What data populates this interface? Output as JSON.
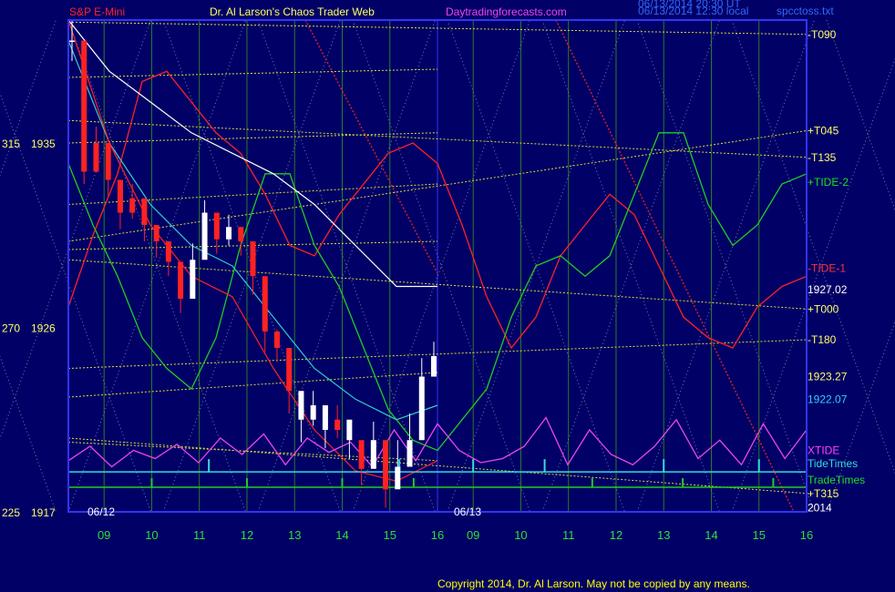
{
  "header": {
    "instrument": "S&P E-Mini",
    "title": "Dr. Al Larson's Chaos Trader Web",
    "site": "Daytradingforecasts.com",
    "stamp1": "06/13/2014 20:30 UT",
    "stamp2": "06/13/2014 12:30 local",
    "file": "spcctoss.txt"
  },
  "footer": {
    "copyright": "Copyright 2014, Dr. Al Larson. May not be copied by any means."
  },
  "colors": {
    "background": "#000066",
    "frame": "#3333ff",
    "grid": "#2a7a2a",
    "price_up": "#ffffff",
    "price_down": "#ff2222",
    "tide1": "#ff2222",
    "tide2": "#22cc22",
    "xtide": "#ee44ee",
    "tidetimes": "#33dddd",
    "tradetimes": "#22cc22",
    "tlines": "#dddd33",
    "ma_white": "#ffffff",
    "ma_cyan": "#33cccc",
    "ma_red": "#ff2222"
  },
  "chart_data": {
    "type": "line",
    "title": "S&P E-Mini",
    "xlabel": "",
    "ylabel": "",
    "ylim": [
      1917,
      1941
    ],
    "grid": true,
    "x_hours": [
      9,
      10,
      11,
      12,
      13,
      14,
      15,
      16
    ],
    "x_tick_labels": [
      "09",
      "10",
      "11",
      "12",
      "13",
      "14",
      "15",
      "16",
      "09",
      "10",
      "11",
      "12",
      "13",
      "14",
      "15",
      "16"
    ],
    "date_labels": [
      "06/12",
      "06/13"
    ],
    "y_tick_labels": [
      {
        "left": "315",
        "price": "1935",
        "value": 1935
      },
      {
        "left": "270",
        "price": "1926",
        "value": 1926
      },
      {
        "left": "225",
        "price": "1917",
        "value": 1917
      }
    ],
    "right_labels": [
      {
        "text": "-T090",
        "value": 1940.3,
        "color": "#ffff66"
      },
      {
        "text": "+T045",
        "value": 1935.6,
        "color": "#ffff66"
      },
      {
        "text": "-T135",
        "value": 1934.3,
        "color": "#ffff66"
      },
      {
        "text": "+TIDE-2",
        "value": 1933.1,
        "color": "#22dd22"
      },
      {
        "text": "-TIDE-1",
        "value": 1928.9,
        "color": "#ff3333"
      },
      {
        "text": "1927.02",
        "value": 1927.85,
        "color": "#ffffff"
      },
      {
        "text": "+T000",
        "value": 1926.9,
        "color": "#ffff66"
      },
      {
        "text": "-T180",
        "value": 1925.4,
        "color": "#ffff66"
      },
      {
        "text": "1923.27",
        "value": 1923.6,
        "color": "#ffff66"
      },
      {
        "text": "1922.07",
        "value": 1922.5,
        "color": "#33ccff"
      },
      {
        "text": "XTIDE",
        "value": 1920.0,
        "color": "#ff44ff"
      },
      {
        "text": "TideTimes",
        "value": 1919.35,
        "color": "#33dddd"
      },
      {
        "text": "TradeTimes",
        "value": 1918.55,
        "color": "#22dd22"
      },
      {
        "text": "+T315",
        "value": 1917.9,
        "color": "#ffff66"
      },
      {
        "text": "2014",
        "value": 1917.2,
        "color": "#ffffff"
      }
    ],
    "series": [
      {
        "name": "S&P E-Mini",
        "day1_close": [
          1940.0,
          1933.6,
          1935.0,
          1933.2,
          1931.6,
          1932.3,
          1931.0,
          1930.2,
          1929.2,
          1927.4,
          1929.3,
          1931.6,
          1930.3,
          1930.9,
          1930.2,
          1928.5,
          1925.8,
          1925.0,
          1922.9,
          1921.5,
          1922.2,
          1921.0,
          1921.5,
          1920.5,
          1919.1,
          1920.5,
          1918.1,
          1919.2,
          1920.5,
          1923.6,
          1924.6
        ],
        "day1_high": [
          1941.0,
          1935.2,
          1935.8,
          1933.9,
          1932.4,
          1933.0,
          1931.8,
          1930.9,
          1930.0,
          1928.6,
          1930.1,
          1932.2,
          1931.1,
          1931.5,
          1930.9,
          1929.3,
          1926.7,
          1925.9,
          1923.8,
          1922.5,
          1922.9,
          1922.0,
          1922.2,
          1921.3,
          1920.0,
          1921.4,
          1919.8,
          1920.5,
          1921.8,
          1924.5,
          1925.3
        ],
        "day1_low": [
          1939.0,
          1933.0,
          1934.0,
          1932.4,
          1930.8,
          1931.3,
          1930.2,
          1929.4,
          1928.5,
          1926.7,
          1928.5,
          1930.8,
          1929.6,
          1930.0,
          1929.5,
          1927.6,
          1924.8,
          1924.3,
          1921.8,
          1920.4,
          1921.2,
          1920.1,
          1920.6,
          1919.6,
          1918.3,
          1919.4,
          1917.2,
          1918.7,
          1919.5,
          1922.8,
          1923.9
        ],
        "day1_direction": [
          "up",
          "dn",
          "dn",
          "dn",
          "dn",
          "dn",
          "dn",
          "dn",
          "dn",
          "dn",
          "up",
          "up",
          "dn",
          "up",
          "dn",
          "dn",
          "dn",
          "dn",
          "dn",
          "up",
          "up",
          "up",
          "dn",
          "up",
          "dn",
          "up",
          "dn",
          "up",
          "up",
          "up",
          "up"
        ]
      },
      {
        "name": "-T090",
        "kind": "t-line",
        "y_start": 1940.9,
        "y_end": 1940.3
      },
      {
        "name": "+T045",
        "kind": "t-line",
        "y_start": 1930.2,
        "y_end": 1935.6
      },
      {
        "name": "-T135",
        "kind": "t-line",
        "y_start": 1936.1,
        "y_end": 1934.3
      },
      {
        "name": "+T000",
        "kind": "t-line",
        "y_start": 1929.3,
        "y_end": 1926.9
      },
      {
        "name": "-T180",
        "kind": "t-line",
        "y_start": 1924.0,
        "y_end": 1925.4
      },
      {
        "name": "+T315",
        "kind": "t-line",
        "y_start": 1920.6,
        "y_end": 1917.9
      },
      {
        "name": "-TIDE-1",
        "values": [
          1927.0,
          1930.5,
          1933.5,
          1938.0,
          1938.5,
          1937.0,
          1935.5,
          1934.5,
          1932.5,
          1930.0,
          1929.5,
          1931.5,
          1933.0,
          1934.5,
          1935.0,
          1934.0,
          1931.0,
          1927.5,
          1925.0,
          1926.5,
          1929.5,
          1931.0,
          1932.5,
          1931.5,
          1929.0,
          1926.5,
          1925.5,
          1925.0,
          1927.0,
          1928.0,
          1928.5
        ]
      },
      {
        "name": "+TIDE-2",
        "values": [
          1934.0,
          1931.0,
          1928.5,
          1925.5,
          1924.0,
          1923.0,
          1925.5,
          1930.0,
          1933.5,
          1933.5,
          1930.0,
          1928.0,
          1925.0,
          1922.0,
          1920.5,
          1920.0,
          1921.5,
          1923.0,
          1926.5,
          1929.0,
          1929.5,
          1928.5,
          1929.5,
          1932.5,
          1935.5,
          1935.5,
          1932.0,
          1930.0,
          1931.0,
          1933.0,
          1933.5
        ]
      },
      {
        "name": "MA white",
        "values": [
          1941.0,
          1938.5,
          1937.0,
          1935.5,
          1934.5,
          1933.5,
          1932.0,
          1930.0,
          1928.0,
          1928.0
        ]
      },
      {
        "name": "MA cyan",
        "values": [
          1940.0,
          1935.0,
          1932.0,
          1930.0,
          1929.0,
          1926.5,
          1924.0,
          1922.5,
          1921.5,
          1922.2
        ]
      },
      {
        "name": "MA red",
        "values": [
          1941.0,
          1935.0,
          1931.0,
          1928.5,
          1927.5,
          1924.0,
          1921.0,
          1919.0,
          1918.5,
          1919.5
        ]
      },
      {
        "name": "XTIDE",
        "values": [
          1919.5,
          1920.2,
          1919.2,
          1920.0,
          1919.6,
          1920.3,
          1919.4,
          1920.6,
          1919.8,
          1920.8,
          1919.3,
          1920.6,
          1919.9,
          1920.4,
          1919.2,
          1921.0,
          1919.5,
          1921.3,
          1920.0,
          1919.4,
          1919.6,
          1920.2,
          1921.6,
          1919.3,
          1921.0,
          1919.8,
          1919.3,
          1920.2,
          1921.5,
          1919.6,
          1920.5,
          1919.3,
          1921.3,
          1919.6,
          1921.0
        ]
      }
    ],
    "tide_times": [
      11.2,
      15.2,
      9.0,
      10.5,
      13.0,
      15.0,
      16.0
    ],
    "trade_times": [
      10.0,
      12.0,
      14.0,
      15.5,
      11.5,
      13.4,
      15.3
    ]
  }
}
